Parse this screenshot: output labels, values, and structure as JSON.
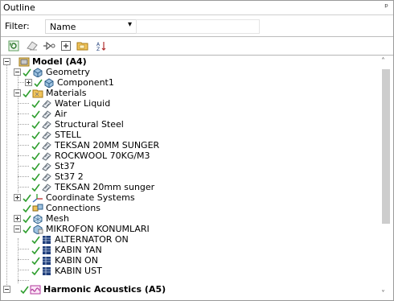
{
  "panel": {
    "title": "Outline",
    "pin_glyph": "ᵖ"
  },
  "filter": {
    "label": "Filter:",
    "value": "Name",
    "arrow": "▾",
    "search_value": ""
  },
  "toolbar": {
    "buttons": [
      {
        "name": "refresh-icon",
        "glyph": "↻",
        "color": "#2f7a2f"
      },
      {
        "name": "clear-filter-icon",
        "glyph": "⌫",
        "color": "#7b7b7b"
      },
      {
        "name": "connect-icon",
        "glyph": "⊳",
        "color": "#555555"
      },
      {
        "name": "expand-all-icon",
        "glyph": "⊞",
        "color": "#555555"
      },
      {
        "name": "folder-icon",
        "glyph": "▣",
        "color": "#d49a1c"
      },
      {
        "name": "sort-icon",
        "glyph": "↕",
        "color": "#a0522d"
      }
    ]
  },
  "tree": {
    "model": {
      "label": "Model (A4)"
    },
    "geometry": {
      "label": "Geometry"
    },
    "component": {
      "label": "Component1"
    },
    "materials": {
      "label": "Materials",
      "items": [
        "Water Liquid",
        "Air",
        "Structural Steel",
        "STELL",
        "TEKSAN 20MM SUNGER",
        "ROCKWOOL 70KG/M3",
        "St37",
        "St37 2",
        "TEKSAN 20mm sunger"
      ]
    },
    "coordinate_systems": {
      "label": "Coordinate Systems"
    },
    "connections": {
      "label": "Connections"
    },
    "mesh": {
      "label": "Mesh"
    },
    "mikrofon": {
      "label": "MIKROFON KONUMLARI",
      "items": [
        "ALTERNATOR ON",
        "KABIN YAN",
        "KABIN ON",
        "KABIN UST"
      ]
    },
    "harmonic": {
      "label": "Harmonic Acoustics (A5)"
    }
  },
  "scrollbar": {
    "up_glyph": "˄",
    "down_glyph": "˅",
    "thumb_fraction": 0.63
  },
  "colors": {
    "check": "#2e9e2e",
    "material_icon": "#7a8a96",
    "folder": "#d4a52a",
    "table_icon": "#1f3d7a",
    "harmonic": "#b0379c"
  }
}
